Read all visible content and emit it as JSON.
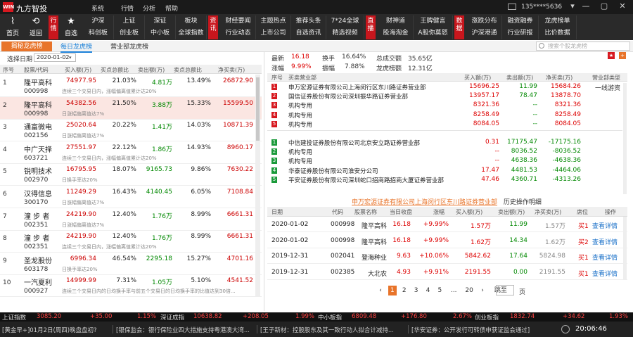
{
  "app": {
    "logo": "WIN",
    "title": "九方智投",
    "account": "135****5636"
  },
  "menu": [
    "系统",
    "行情",
    "分析",
    "帮助"
  ],
  "toolbar": {
    "home": "首页",
    "back": "返回",
    "watch": "自选",
    "hangqing_label": "行情",
    "zixun_label": "资讯",
    "zhibo_label": "直播",
    "shuju_label": "数据",
    "grid1": [
      [
        "沪深",
        "上证",
        "深证",
        "板块"
      ],
      [
        "科创板",
        "创业板",
        "中小板",
        "全球指数"
      ]
    ],
    "grid2": [
      [
        "财经要闻",
        "主题热点",
        "推荐头条",
        "7*24全球"
      ],
      [
        "行业动态",
        "上市公司",
        "自选资讯",
        "精选视频"
      ]
    ],
    "grid3": [
      [
        "财神道",
        "王牌健言"
      ],
      [
        "股海淘金",
        "A股你莫怒"
      ]
    ],
    "grid4": [
      [
        "涨跌分布",
        "融资融券",
        "龙虎榜单"
      ],
      [
        "沪深港通",
        "行业研报",
        "比价数据"
      ]
    ]
  },
  "tabs": {
    "reveal": "揭秘龙虎榜",
    "daily": "每日龙虎榜",
    "branch": "营业部龙虎榜",
    "search_placeholder": "搜索个股龙虎榜"
  },
  "left": {
    "date_label": "选择日期",
    "date_value": "2020-01-02",
    "headers": [
      "序号",
      "股票/代码",
      "买入额(万)",
      "买点总额比",
      "卖出额(万)",
      "卖点总额比",
      "净买卖(万)"
    ],
    "rows": [
      {
        "n": "1",
        "name": "隆平高科",
        "code": "000998",
        "desc": "连续三个交易日内，涨幅偏离值累计达20%",
        "buy": "74977.95",
        "bp": "21.03%",
        "sell": "4.81万",
        "sp": "13.49%",
        "net": "26872.90"
      },
      {
        "n": "2",
        "name": "隆平高科",
        "code": "000998",
        "desc": "日涨幅偏离值达7%",
        "buy": "54382.56",
        "bp": "21.50%",
        "sell": "3.88万",
        "sp": "15.33%",
        "net": "15599.50"
      },
      {
        "n": "3",
        "name": "通富微电",
        "code": "002156",
        "desc": "日涨幅偏离值达7%",
        "buy": "25020.64",
        "bp": "20.22%",
        "sell": "1.41万",
        "sp": "14.03%",
        "net": "10871.39"
      },
      {
        "n": "4",
        "name": "中广天择",
        "code": "603721",
        "desc": "连续三个交易日内，涨幅偏离值累计达20%",
        "buy": "27551.97",
        "bp": "22.12%",
        "sell": "1.86万",
        "sp": "14.93%",
        "net": "8960.17"
      },
      {
        "n": "5",
        "name": "锐明技术",
        "code": "002970",
        "desc": "日换手率达20%",
        "buy": "16795.95",
        "bp": "18.07%",
        "sell": "9165.73",
        "sp": "9.86%",
        "net": "7630.22"
      },
      {
        "n": "6",
        "name": "汉得信息",
        "code": "300170",
        "desc": "日涨幅偏离值达7%",
        "buy": "11249.29",
        "bp": "16.43%",
        "sell": "4140.45",
        "sp": "6.05%",
        "net": "7108.84"
      },
      {
        "n": "7",
        "name": "潼 步 者",
        "code": "002351",
        "desc": "日涨幅偏离值达7%",
        "buy": "24219.90",
        "bp": "12.40%",
        "sell": "1.76万",
        "sp": "8.99%",
        "net": "6661.31"
      },
      {
        "n": "8",
        "name": "潼 步 者",
        "code": "002351",
        "desc": "连续三个交易日内，涨幅偏离值累计达20%",
        "buy": "24219.90",
        "bp": "12.40%",
        "sell": "1.76万",
        "sp": "8.99%",
        "net": "6661.31"
      },
      {
        "n": "9",
        "name": "圣龙股份",
        "code": "603178",
        "desc": "日换手率达20%",
        "buy": "6996.34",
        "bp": "46.54%",
        "sell": "2295.18",
        "sp": "15.27%",
        "net": "4701.16"
      },
      {
        "n": "10",
        "name": "一汽夏利",
        "code": "000927",
        "desc": "连续三个交易日内的日均换手率与前五个交易日的日均换手率的比值达到30倍...",
        "buy": "14999.99",
        "bp": "7.31%",
        "sell": "1.05万",
        "sp": "5.10%",
        "net": "4541.52"
      }
    ]
  },
  "stats": {
    "zuixin_label": "最新",
    "zuixin": "16.18",
    "huanshou_label": "换手",
    "huanshou": "16.64%",
    "zongchengjiao_label": "总成交额",
    "zongchengjiao": "35.65亿",
    "zhangfu_label": "涨幅",
    "zhangfu": "9.99%",
    "zhenfu_label": "振幅",
    "zhenfu": "7.88%",
    "longhu_label": "龙虎榜额",
    "longhu": "12.31亿"
  },
  "right": {
    "headers": [
      "序号",
      "买卖营业部",
      "买入额(万)",
      "卖出额(万)",
      "净买卖(万)",
      "营业部类型"
    ],
    "buy_rows": [
      {
        "n": "1",
        "name": "申万宏源证券有限公司上海闵行区东川路证券营业部",
        "b": "15696.25",
        "s": "11.99",
        "net": "15684.26",
        "type": "一线游资"
      },
      {
        "n": "2",
        "name": "国信证券股份有限公司深圳振华路证券营业部",
        "b": "13957.17",
        "s": "78.47",
        "net": "13878.70",
        "type": ""
      },
      {
        "n": "3",
        "name": "机构专用",
        "b": "8321.36",
        "s": "--",
        "net": "8321.36",
        "type": ""
      },
      {
        "n": "4",
        "name": "机构专用",
        "b": "8258.49",
        "s": "--",
        "net": "8258.49",
        "type": ""
      },
      {
        "n": "5",
        "name": "机构专用",
        "b": "8084.05",
        "s": "--",
        "net": "8084.05",
        "type": ""
      }
    ],
    "sell_rows": [
      {
        "n": "1",
        "name": "中信建投证券股份有限公司北京安立路证券营业部",
        "b": "0.31",
        "s": "17175.47",
        "net": "-17175.16",
        "type": ""
      },
      {
        "n": "2",
        "name": "机构专用",
        "b": "--",
        "s": "8036.52",
        "net": "-8036.52",
        "type": ""
      },
      {
        "n": "3",
        "name": "机构专用",
        "b": "--",
        "s": "4638.36",
        "net": "-4638.36",
        "type": ""
      },
      {
        "n": "4",
        "name": "华泰证券股份有限公司淮安分公司",
        "b": "17.47",
        "s": "4481.53",
        "net": "-4464.06",
        "type": ""
      },
      {
        "n": "5",
        "name": "平安证券股份有限公司深圳蛇口招商路招商大厦证券营业部",
        "b": "47.46",
        "s": "4360.71",
        "net": "-4313.26",
        "type": ""
      }
    ]
  },
  "history": {
    "title": "申万宏源证券有限公司上海闵行区东川路证券营业部",
    "suffix": "历史操作明细",
    "headers": [
      "日期",
      "代码",
      "股票名称",
      "当日收盘",
      "涨幅",
      "买入额(万)",
      "卖出额(万)",
      "净买卖(万)",
      "席位",
      "操作"
    ],
    "rows": [
      {
        "date": "2020-01-02",
        "code": "000998",
        "name": "隆平高科",
        "close": "16.18",
        "chg": "+9.99%",
        "b": "1.57万",
        "s": "11.99",
        "net": "1.57万",
        "seat": "买1",
        "op": "查看详情"
      },
      {
        "date": "2020-01-02",
        "code": "000998",
        "name": "隆平高科",
        "close": "16.18",
        "chg": "+9.99%",
        "b": "1.62万",
        "s": "14.34",
        "net": "1.62万",
        "seat": "买2",
        "op": "查看详情"
      },
      {
        "date": "2019-12-31",
        "code": "002041",
        "name": "登海种业",
        "close": "9.63",
        "chg": "+10.06%",
        "b": "5842.62",
        "s": "17.64",
        "net": "5824.98",
        "seat": "买1",
        "op": "查看详情"
      },
      {
        "date": "2019-12-31",
        "code": "002385",
        "name": "大北农",
        "close": "4.93",
        "chg": "+9.91%",
        "b": "2191.55",
        "s": "0.00",
        "net": "2191.55",
        "seat": "买1",
        "op": "查看详情"
      }
    ],
    "pages": [
      "1",
      "2",
      "3",
      "4",
      "5",
      "...",
      "20"
    ],
    "goto_label": "跳至",
    "page_label": "页"
  },
  "indices": [
    {
      "name": "上证指数",
      "val": "3085.20",
      "chg": "+35.00",
      "pct": "1.15%"
    },
    {
      "name": "深证成指",
      "val": "10638.82",
      "chg": "+208.05",
      "pct": "1.99%"
    },
    {
      "name": "中小板指",
      "val": "6809.48",
      "chg": "+176.80",
      "pct": "2.67%"
    },
    {
      "name": "创业板指",
      "val": "1832.74",
      "chg": "+34.62",
      "pct": "1.93%"
    }
  ],
  "news": {
    "n1": "[黄金早+]01月2日(周四)晚盘盘初?",
    "n2": "[银保监会：银行保险业四大措施支持粤港澳大湾...",
    "n3": "[王子新材：控股股东及其一致行动人拟合计减持...",
    "n4": "[华安证券：公开发行可转债申获证监会通过]",
    "time": "20:06:46"
  }
}
